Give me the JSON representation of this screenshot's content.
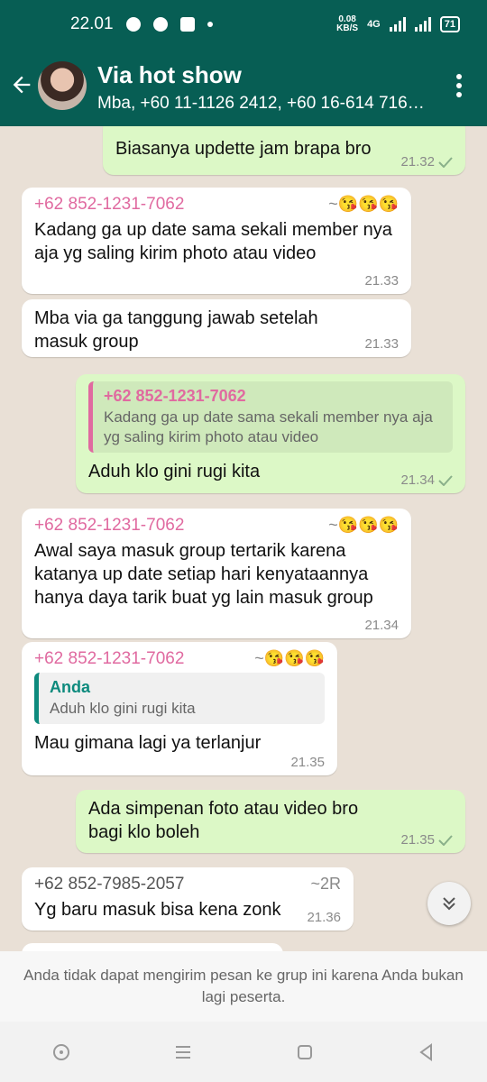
{
  "status_bar": {
    "time": "22.01",
    "speed_value": "0.08",
    "speed_unit": "KB/S",
    "network": "4G",
    "battery": "71"
  },
  "header": {
    "title": "Via hot show",
    "subtitle": "Mba, +60 11-1126 2412, +60 16-614 716…"
  },
  "messages": [
    {
      "text": "Biasanya updette jam brapa bro",
      "time": "21.32"
    },
    {
      "sender": "+62 852-1231-7062",
      "suffix": "~😘😘😘",
      "text": "Kadang ga up date sama sekali member nya aja yg saling kirim photo atau video",
      "time": "21.33"
    },
    {
      "text": "Mba via ga tanggung jawab setelah masuk group",
      "time": "21.33"
    },
    {
      "quote_name": "+62 852-1231-7062",
      "quote_text": "Kadang ga up date sama sekali member nya aja yg saling kirim photo atau video",
      "text": "Aduh klo gini rugi kita",
      "time": "21.34"
    },
    {
      "sender": "+62 852-1231-7062",
      "suffix": "~😘😘😘",
      "text": "Awal saya masuk group tertarik karena katanya up date setiap hari kenyataannya hanya daya tarik buat yg lain masuk group",
      "time": "21.34"
    },
    {
      "sender": "+62 852-1231-7062",
      "suffix": "~😘😘😘",
      "quote_name": "Anda",
      "quote_text": "Aduh klo gini rugi kita",
      "text": "Mau gimana lagi ya terlanjur",
      "time": "21.35"
    },
    {
      "text": "Ada simpenan foto atau video bro bagi klo boleh",
      "time": "21.35"
    },
    {
      "sender": "+62 852-7985-2057",
      "suffix": "~2R",
      "text": "Yg baru masuk bisa kena zonk",
      "time": "21.36"
    }
  ],
  "footer_notice": "Anda tidak dapat mengirim pesan ke grup ini karena Anda bukan lagi peserta.",
  "colors": {
    "header": "#075e54",
    "outgoing": "#dcf8c6",
    "incoming": "#ffffff",
    "sender": "#e06aa0",
    "you": "#0d8a7d"
  },
  "icons": [
    "back-arrow-icon",
    "more-vert-icon",
    "double-chevron-down-icon",
    "check-icon"
  ]
}
